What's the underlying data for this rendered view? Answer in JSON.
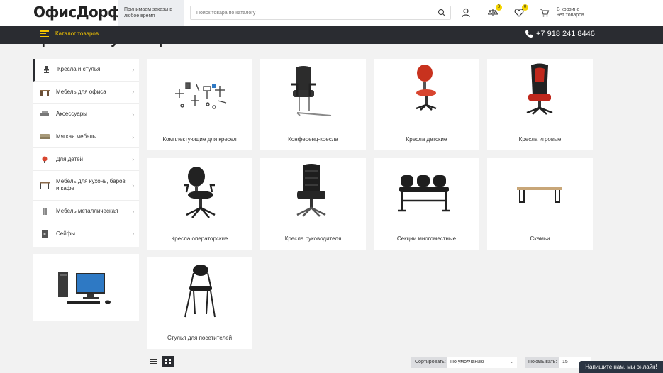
{
  "header": {
    "logo_main": "ОфисДорф",
    "logo_dot": ".",
    "promo_line1": "Принимаем заказы в",
    "promo_line2": "любое время",
    "search_placeholder": "Поиск товара по каталогу",
    "compare_count": "0",
    "favorites_count": "0",
    "cart_line1": "В корзине",
    "cart_line2": "нет товаров"
  },
  "nav": {
    "catalog_label": "Каталог товаров",
    "phone": "+7 918 241 8446"
  },
  "page_title": "Кресла и стулья офисные",
  "sidebar": {
    "items": [
      {
        "label": "Кресла и стулья",
        "chevron": "›"
      },
      {
        "label": "Мебель для офиса",
        "chevron": "›"
      },
      {
        "label": "Аксессуары",
        "chevron": "›"
      },
      {
        "label": "Мягкая мебель",
        "chevron": "›"
      },
      {
        "label": "Для детей",
        "chevron": "›"
      },
      {
        "label": "Мебель для кухонь, баров и кафе",
        "chevron": "›"
      },
      {
        "label": "Мебель металлическая",
        "chevron": "›"
      },
      {
        "label": "Сейфы",
        "chevron": "›"
      }
    ]
  },
  "products": [
    {
      "label": "Комплектующие для кресел",
      "icon": "chair-parts-icon"
    },
    {
      "label": "Конференц-кресла",
      "icon": "conference-chair-icon"
    },
    {
      "label": "Кресла детские",
      "icon": "kids-chair-icon"
    },
    {
      "label": "Кресла игровые",
      "icon": "gaming-chair-icon"
    },
    {
      "label": "Кресла операторские",
      "icon": "operator-chair-icon"
    },
    {
      "label": "Кресла руководителя",
      "icon": "executive-chair-icon"
    },
    {
      "label": "Секции многоместные",
      "icon": "multi-seat-icon"
    },
    {
      "label": "Скамьи",
      "icon": "bench-icon"
    },
    {
      "label": "Стулья для посетителей",
      "icon": "visitor-chair-icon"
    }
  ],
  "toolbar": {
    "sort_label": "Сортировать:",
    "sort_value": "По умолчанию",
    "show_label": "Показывать:",
    "show_value": "15"
  },
  "chat_label": "Напишите нам, мы онлайн!",
  "colors": {
    "accent": "#f5c500",
    "dark": "#2a2c31",
    "brand_red": "#d62e1f"
  }
}
